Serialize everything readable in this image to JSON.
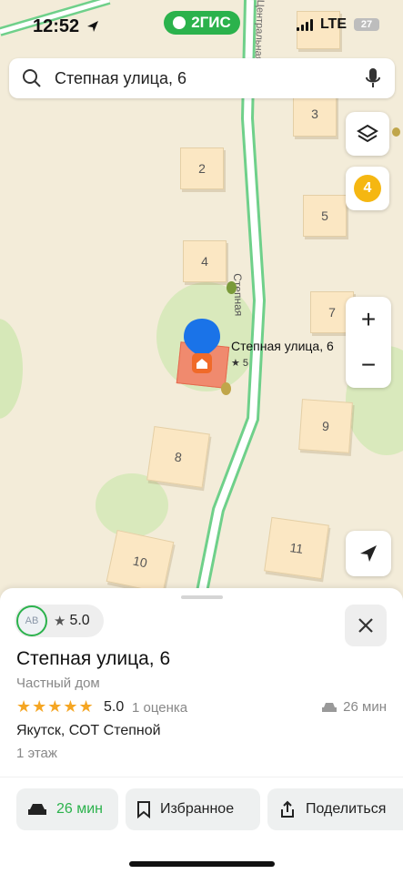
{
  "status_bar": {
    "time": "12:52",
    "network": "LTE",
    "battery": "27"
  },
  "brand": {
    "name": "2ГИС",
    "color": "#2bb24c"
  },
  "search": {
    "value": "Степная улица, 6"
  },
  "map": {
    "layers_badge": "4",
    "zoom_in": "+",
    "zoom_out": "−",
    "road_label": "Степная",
    "road_label_top": "Центральная",
    "houses": [
      "2",
      "3",
      "4",
      "5",
      "7",
      "8",
      "9",
      "10",
      "11"
    ],
    "pin_label": "Степная улица, 6",
    "pin_rating": "★ 5"
  },
  "card": {
    "rating": "5.0",
    "avatar_initials": "АВ",
    "title": "Степная улица, 6",
    "type": "Частный дом",
    "stars": "★★★★★",
    "score": "5.0",
    "reviews": "1 оценка",
    "drive_time": "26 мин",
    "address": "Якутск, СОТ Степной",
    "floors": "1 этаж"
  },
  "actions": {
    "route": "26 мин",
    "favorite": "Избранное",
    "share": "Поделиться"
  }
}
